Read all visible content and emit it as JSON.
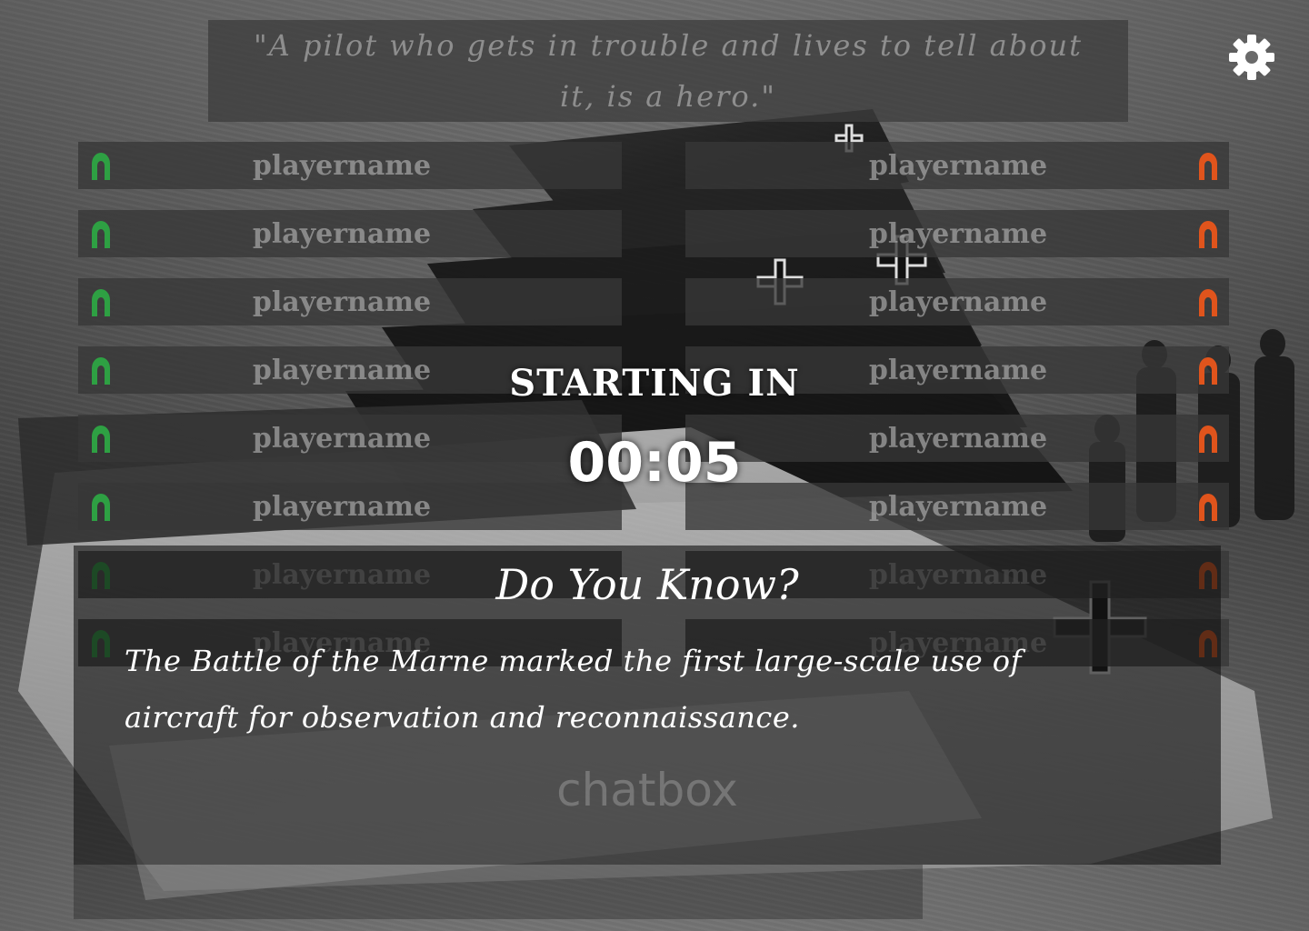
{
  "quote": {
    "text": "\"A pilot who gets in trouble and lives to tell about it, is a hero.\""
  },
  "settings": {
    "icon": "gear-icon"
  },
  "teams": {
    "left": {
      "color": "#2ea043",
      "players": [
        "playername",
        "playername",
        "playername",
        "playername",
        "playername",
        "playername",
        "playername",
        "playername"
      ]
    },
    "right": {
      "color": "#e0541c",
      "players": [
        "playername",
        "playername",
        "playername",
        "playername",
        "playername",
        "playername",
        "playername",
        "playername"
      ]
    }
  },
  "countdown": {
    "label": "STARTING IN",
    "time": "00:05"
  },
  "fact": {
    "title": "Do You Know?",
    "text": "The Battle of the Marne marked the first large-scale use of aircraft for observation and reconnaissance."
  },
  "chatbox": {
    "placeholder": "chatbox"
  }
}
